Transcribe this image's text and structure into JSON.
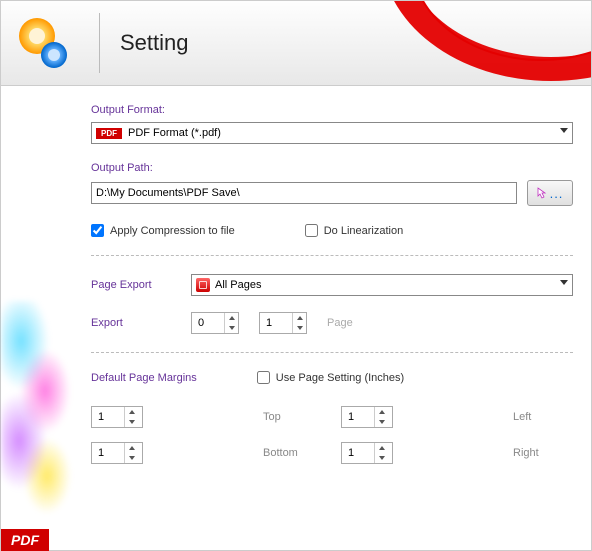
{
  "header": {
    "title": "Setting"
  },
  "outputFormat": {
    "label": "Output Format:",
    "badge": "PDF",
    "value": "PDF Format (*.pdf)"
  },
  "outputPath": {
    "label": "Output Path:",
    "value": "D:\\My Documents\\PDF Save\\",
    "browse": "..."
  },
  "options": {
    "compression": {
      "label": "Apply Compression to file",
      "checked": true
    },
    "linearization": {
      "label": "Do Linearization",
      "checked": false
    }
  },
  "pageExport": {
    "label": "Page Export",
    "value": "All Pages",
    "exportLabel": "Export",
    "from": "0",
    "to": "1",
    "unit": "Page"
  },
  "margins": {
    "label": "Default Page Margins",
    "usePageSetting": {
      "label": "Use Page Setting (Inches)",
      "checked": false
    },
    "top": {
      "label": "Top",
      "value": "1"
    },
    "left": {
      "label": "Left",
      "value": "1"
    },
    "bottom": {
      "label": "Bottom",
      "value": "1"
    },
    "right": {
      "label": "Right",
      "value": "1"
    }
  },
  "sideBadge": "PDF"
}
